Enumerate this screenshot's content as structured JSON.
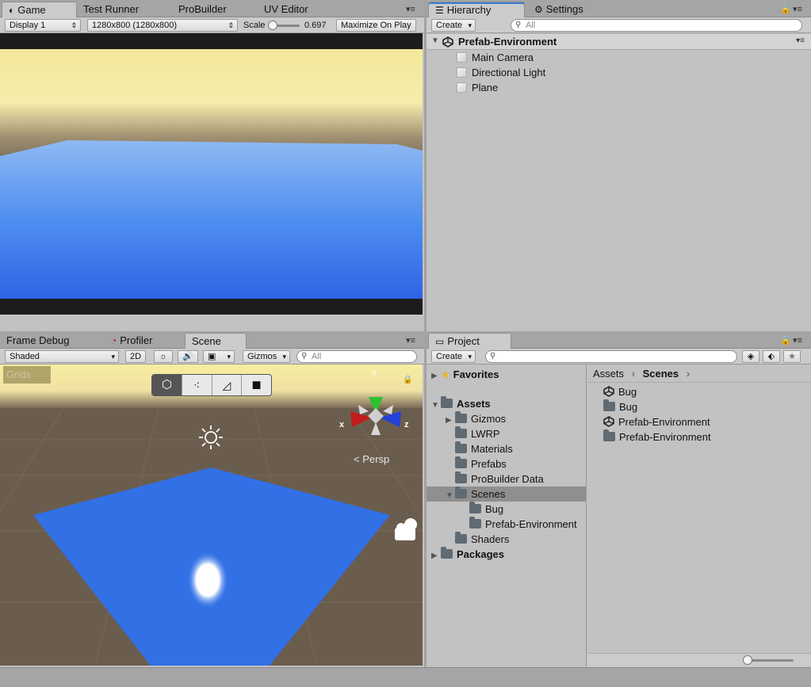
{
  "game": {
    "tabs": [
      "Game",
      "Test Runner",
      "ProBuilder",
      "UV Editor"
    ],
    "display": "Display 1",
    "resolution": "1280x800 (1280x800)",
    "scale_label": "Scale",
    "scale_value": "0.697",
    "maximize": "Maximize On Play"
  },
  "hierarchy": {
    "tabs": [
      "Hierarchy",
      "Settings"
    ],
    "create": "Create",
    "search_placeholder": "All",
    "scene": "Prefab-Environment",
    "items": [
      "Main Camera",
      "Directional Light",
      "Plane"
    ]
  },
  "scene_panel": {
    "tabs": [
      "Frame Debug",
      "Profiler",
      "Scene"
    ],
    "shading": "Shaded",
    "mode_2d": "2D",
    "gizmos": "Gizmos",
    "search_placeholder": "All",
    "overlay_label": "Grids",
    "persp": "Persp",
    "axis_x": "x",
    "axis_z": "z",
    "axis_y": "y"
  },
  "project": {
    "tab": "Project",
    "create": "Create",
    "favorites": "Favorites",
    "assets": "Assets",
    "tree": [
      "Gizmos",
      "LWRP",
      "Materials",
      "Prefabs",
      "ProBuilder Data",
      "Scenes"
    ],
    "scenes_children": [
      "Bug",
      "Prefab-Environment"
    ],
    "shaders": "Shaders",
    "packages": "Packages",
    "breadcrumb": [
      "Assets",
      "Scenes"
    ],
    "files": [
      {
        "name": "Bug",
        "kind": "unity-scene"
      },
      {
        "name": "Bug",
        "kind": "folder"
      },
      {
        "name": "Prefab-Environment",
        "kind": "unity-scene"
      },
      {
        "name": "Prefab-Environment",
        "kind": "folder"
      }
    ]
  },
  "colors": {
    "selected_row": "#8f8f8f",
    "accent_blue": "#3a7bd5",
    "plane_blue": "#3270e6"
  }
}
